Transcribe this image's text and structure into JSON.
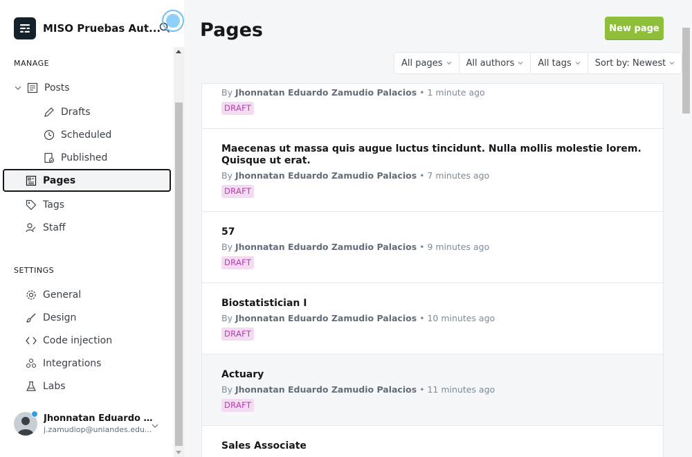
{
  "app": {
    "title": "MISO Pruebas Aut..."
  },
  "sidebar": {
    "manage_label": "MANAGE",
    "settings_label": "SETTINGS",
    "manage_items": [
      {
        "label": "Posts",
        "icon": "posts-icon"
      },
      {
        "label": "Drafts",
        "icon": "pencil-icon"
      },
      {
        "label": "Scheduled",
        "icon": "clock-icon"
      },
      {
        "label": "Published",
        "icon": "published-icon"
      },
      {
        "label": "Pages",
        "icon": "pages-icon",
        "active": true
      },
      {
        "label": "Tags",
        "icon": "tag-icon"
      },
      {
        "label": "Staff",
        "icon": "staff-icon"
      }
    ],
    "settings_items": [
      {
        "label": "General",
        "icon": "gear-icon"
      },
      {
        "label": "Design",
        "icon": "brush-icon"
      },
      {
        "label": "Code injection",
        "icon": "code-icon"
      },
      {
        "label": "Integrations",
        "icon": "integrations-icon"
      },
      {
        "label": "Labs",
        "icon": "flask-icon"
      }
    ],
    "user": {
      "name": "Jhonnatan Eduardo Za...",
      "email": "j.zamudiop@uniandes.edu..."
    }
  },
  "main": {
    "title": "Pages",
    "new_button": "New page",
    "filters": {
      "type": "All pages",
      "authors": "All authors",
      "tags": "All tags",
      "sort": "Sort by: Newest"
    },
    "pages": [
      {
        "title": "",
        "author": "Jhonnatan Eduardo Zamudio Palacios",
        "time": " • 1 minute ago",
        "status": "DRAFT"
      },
      {
        "title": "Maecenas ut massa quis augue luctus tincidunt. Nulla mollis molestie lorem. Quisque ut erat.",
        "author": "Jhonnatan Eduardo Zamudio Palacios",
        "time": " • 7 minutes ago",
        "status": "DRAFT"
      },
      {
        "title": "57",
        "author": "Jhonnatan Eduardo Zamudio Palacios",
        "time": " • 9 minutes ago",
        "status": "DRAFT"
      },
      {
        "title": "Biostatistician I",
        "author": "Jhonnatan Eduardo Zamudio Palacios",
        "time": " • 10 minutes ago",
        "status": "DRAFT"
      },
      {
        "title": "Actuary",
        "author": "Jhonnatan Eduardo Zamudio Palacios",
        "time": " • 11 minutes ago",
        "status": "DRAFT"
      },
      {
        "title": "Sales Associate",
        "author": "",
        "time": "",
        "status": ""
      }
    ],
    "by_label": "By "
  },
  "colors": {
    "accent_green": "#8fbf3a",
    "draft_badge_bg": "#f3dbf1",
    "draft_badge_text": "#b43bb0"
  }
}
